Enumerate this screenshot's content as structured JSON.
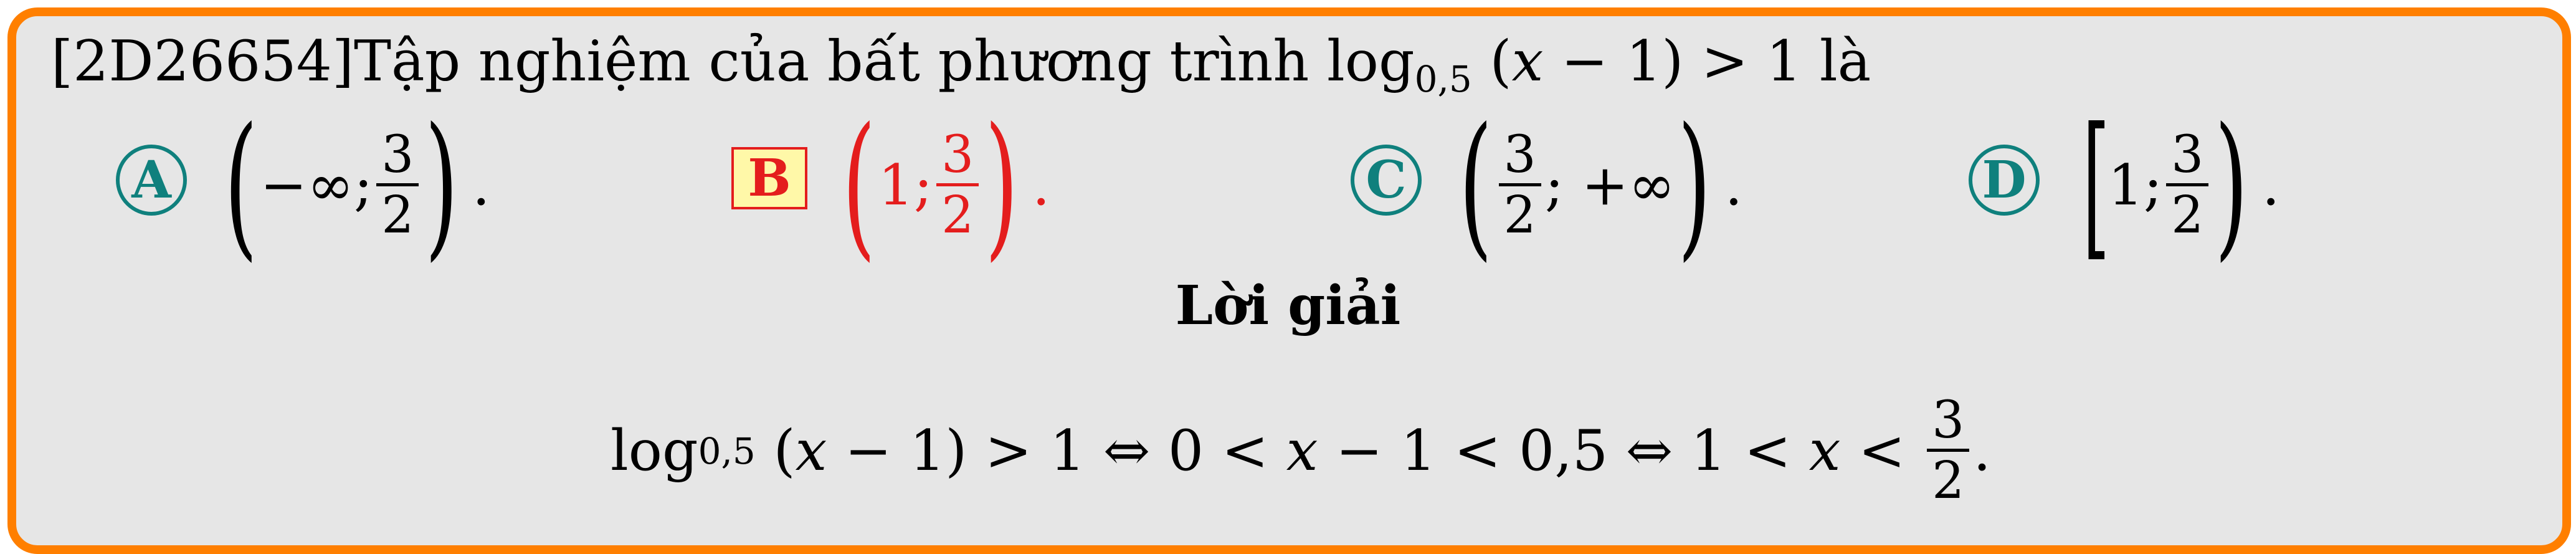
{
  "question": {
    "code": "[2D26654]",
    "text_before": "Tập nghiệm của bất phương trình log",
    "log_base": "0,5",
    "text_after_part1": " (",
    "variable": "x",
    "text_after_part2": " − 1) > 1 là"
  },
  "options": [
    {
      "letter": "A",
      "lead": "−∞;",
      "num": "3",
      "den": "2",
      "trail": "",
      "end": "."
    },
    {
      "letter": "B",
      "lead": "1;",
      "num": "3",
      "den": "2",
      "trail": "",
      "end": "."
    },
    {
      "letter": "C",
      "lead": "",
      "num": "3",
      "den": "2",
      "trail": "; +∞",
      "end": "."
    },
    {
      "letter": "D",
      "lead": "1;",
      "num": "3",
      "den": "2",
      "trail": "",
      "end": "."
    }
  ],
  "solution": {
    "title": "Lời giải",
    "log": "log",
    "log_base": "0,5",
    "part1": " (",
    "var": "x",
    "part2": " − 1) > 1 ⇔ 0 < ",
    "var2": "x",
    "part3": " − 1 < 0,5 ⇔ 1 < ",
    "var3": "x",
    "part4": " < ",
    "num": "3",
    "den": "2",
    "end": "."
  },
  "colors": {
    "border": "#ff7f00",
    "card_bg": "#e6e6e6",
    "circle": "#0f807d",
    "answer": "#e41d1d",
    "answer_box_bg": "#fff8a8"
  }
}
